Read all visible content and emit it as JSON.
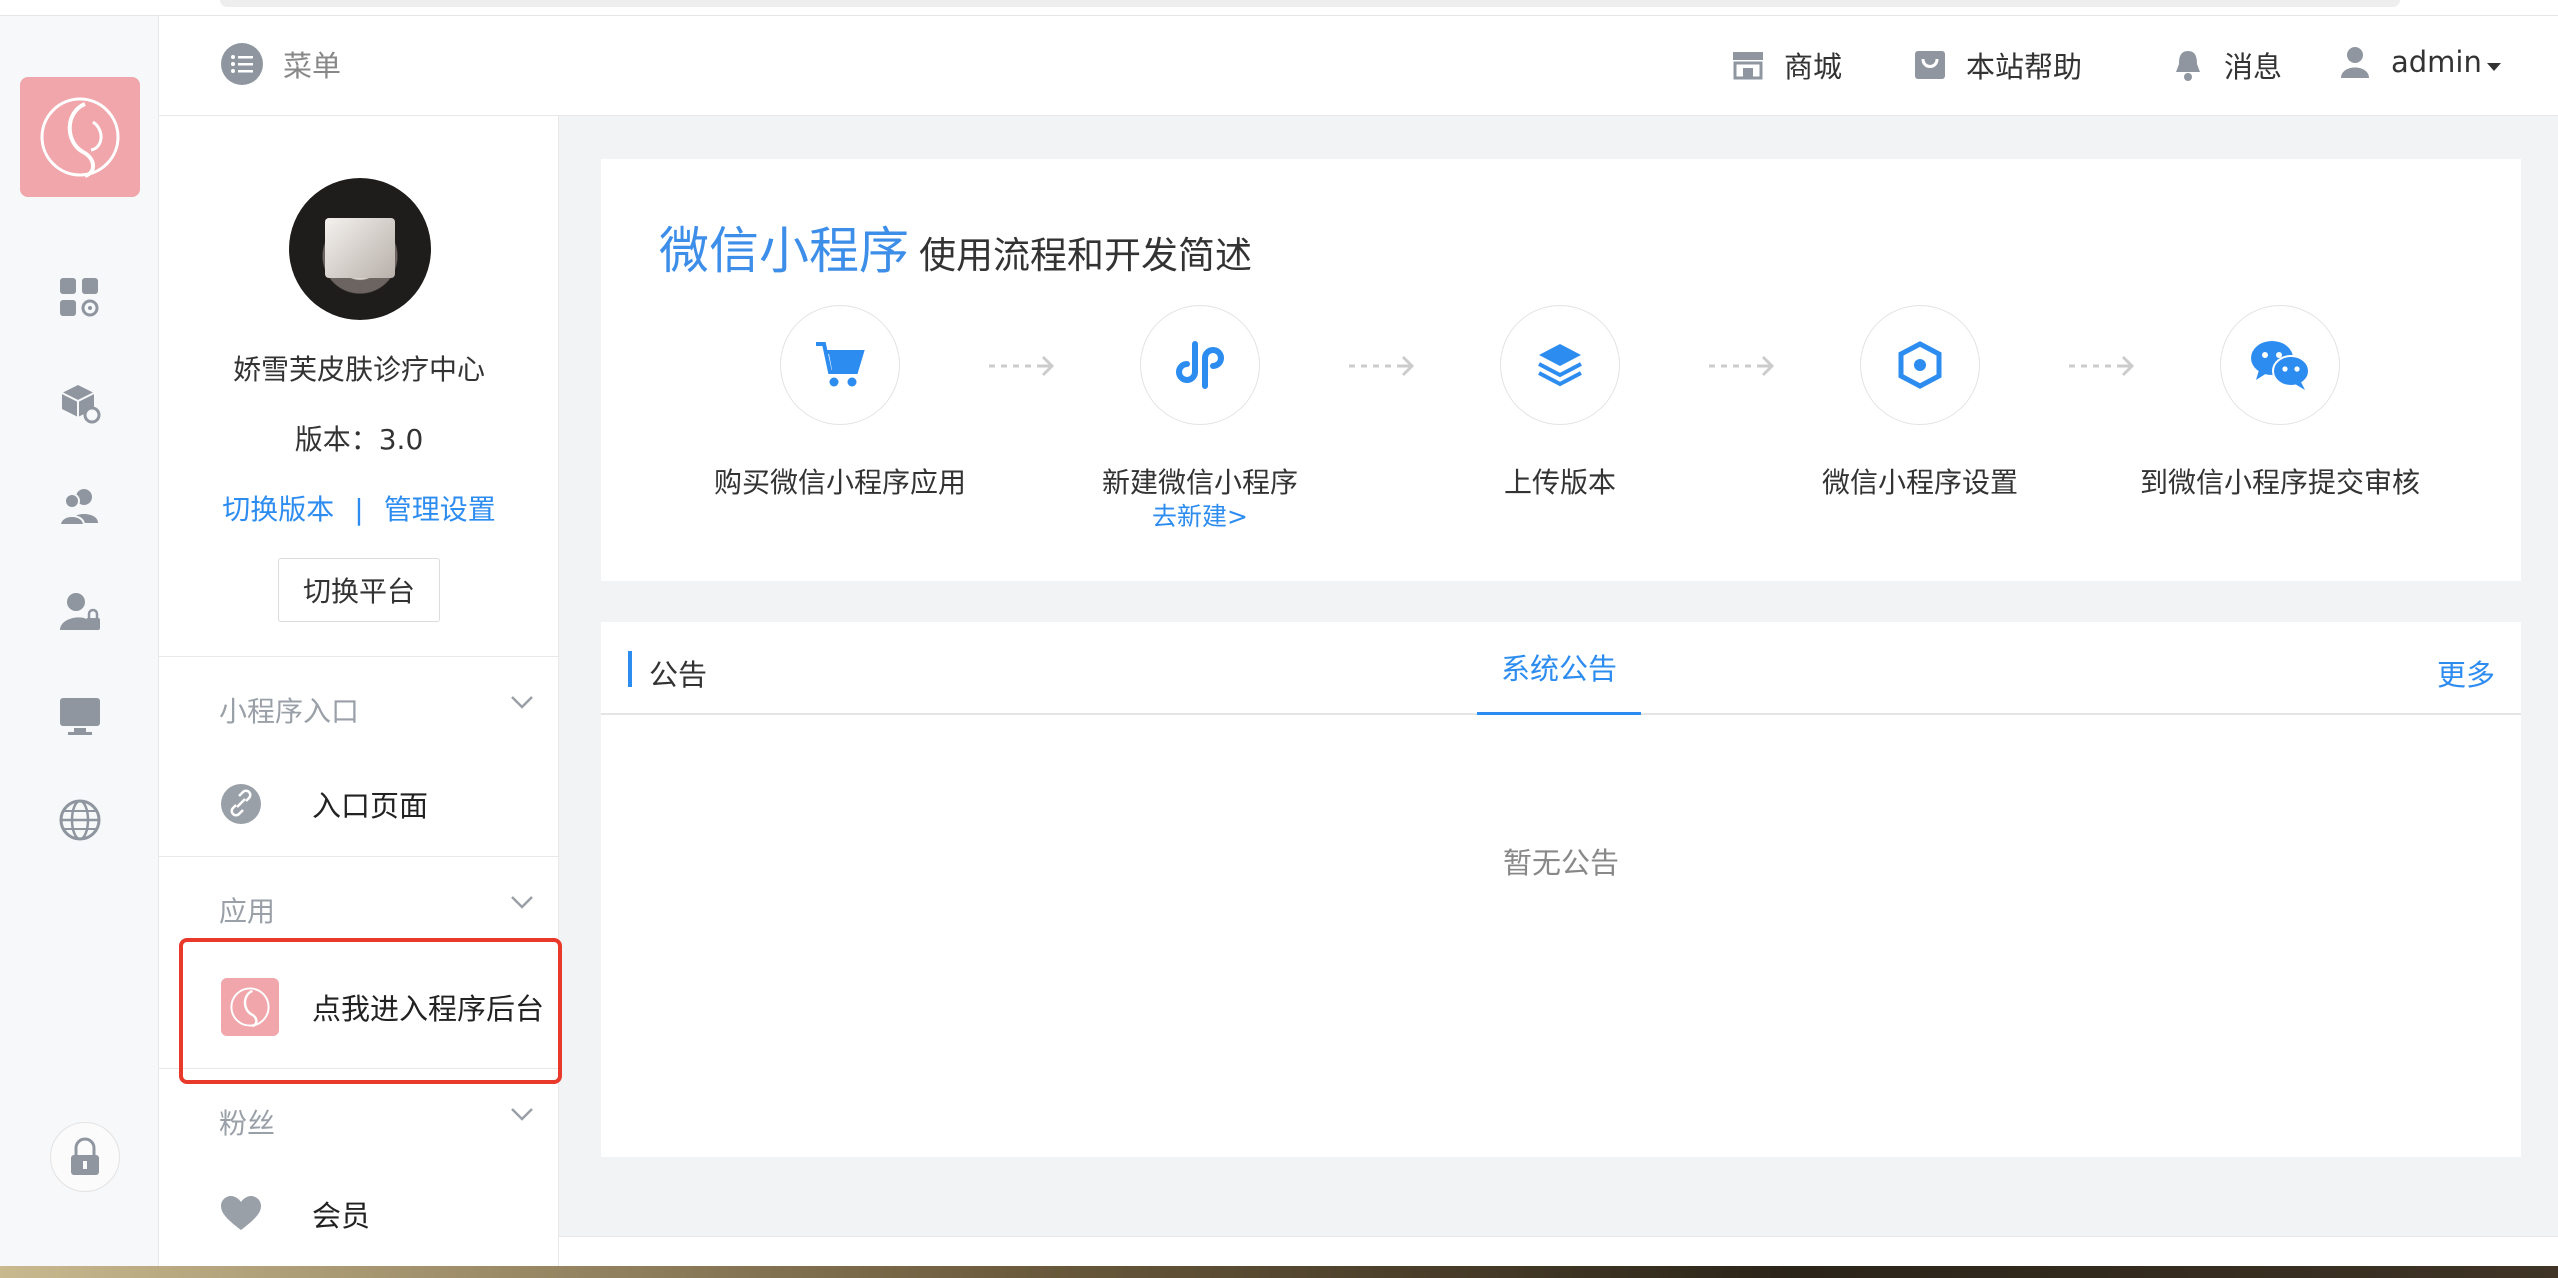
{
  "header": {
    "menu_label": "菜单",
    "nav": [
      {
        "label": "商城",
        "icon": "store-icon"
      },
      {
        "label": "本站帮助",
        "icon": "help-bag-icon"
      },
      {
        "label": "消息",
        "icon": "bell-icon"
      },
      {
        "label": "admin",
        "icon": "user-icon"
      }
    ]
  },
  "rail": {
    "icons": [
      "apps-settings-icon",
      "box-settings-icon",
      "users-icon",
      "user-lock-icon",
      "monitor-icon",
      "globe-icon",
      "lock-icon"
    ]
  },
  "panel": {
    "org_name": "娇雪芙皮肤诊疗中心",
    "version": "版本：3.0",
    "switch_version": "切换版本",
    "separator": "|",
    "manage_settings": "管理设置",
    "switch_platform": "切换平台",
    "sections": [
      {
        "title": "小程序入口",
        "item": "入口页面"
      },
      {
        "title": "应用",
        "item": "点我进入程序后台"
      },
      {
        "title": "粉丝",
        "item": "会员"
      }
    ]
  },
  "intro": {
    "title_main": "微信小程序",
    "title_sub": "使用流程和开发简述",
    "steps": [
      {
        "label": "购买微信小程序应用",
        "icon": "cart-icon"
      },
      {
        "label": "新建微信小程序",
        "sub": "去新建>",
        "icon": "link-icon"
      },
      {
        "label": "上传版本",
        "icon": "layers-icon"
      },
      {
        "label": "微信小程序设置",
        "icon": "hexagon-icon"
      },
      {
        "label": "到微信小程序提交审核",
        "icon": "wechat-icon"
      }
    ]
  },
  "notice": {
    "title": "公告",
    "tab": "系统公告",
    "more": "更多",
    "empty": "暂无公告"
  },
  "colors": {
    "accent": "#2d8cf0",
    "brand_pink": "#f0a6aa",
    "highlight": "#e8392b"
  }
}
